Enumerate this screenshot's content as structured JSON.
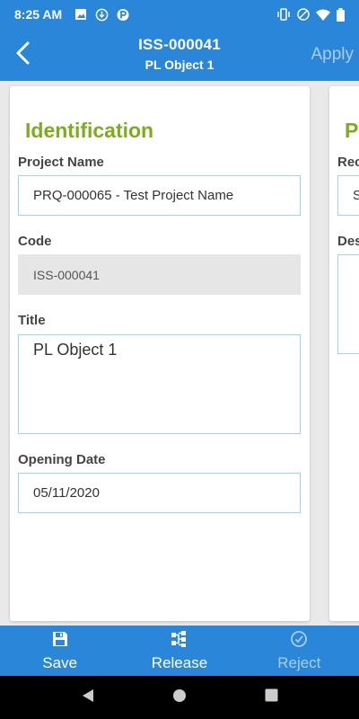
{
  "status_bar": {
    "time": "8:25 AM"
  },
  "app_bar": {
    "title": "ISS-000041",
    "subtitle": "PL Object 1",
    "apply_label": "Apply"
  },
  "identification": {
    "section_title": "Identification",
    "project_name_label": "Project Name",
    "project_name_value": "PRQ-000065 - Test Project Name",
    "code_label": "Code",
    "code_value": "ISS-000041",
    "title_label": "Title",
    "title_value": "PL Object 1",
    "opening_date_label": "Opening Date",
    "opening_date_value": "05/11/2020"
  },
  "peek_card": {
    "section_title_partial": "P",
    "label1_partial": "Rec",
    "value1_partial": "S",
    "label2_partial": "Des"
  },
  "bottom_bar": {
    "save_label": "Save",
    "release_label": "Release",
    "reject_label": "Reject"
  },
  "colors": {
    "primary": "#2a86d9",
    "accent_green": "#7fac1f",
    "field_border": "#9fd1f1",
    "disabled_text": "#a9cdf0"
  },
  "icons": {
    "back": "chevron-left-icon",
    "save": "floppy-disk-icon",
    "release": "release-icon",
    "reject": "reject-circle-icon"
  }
}
